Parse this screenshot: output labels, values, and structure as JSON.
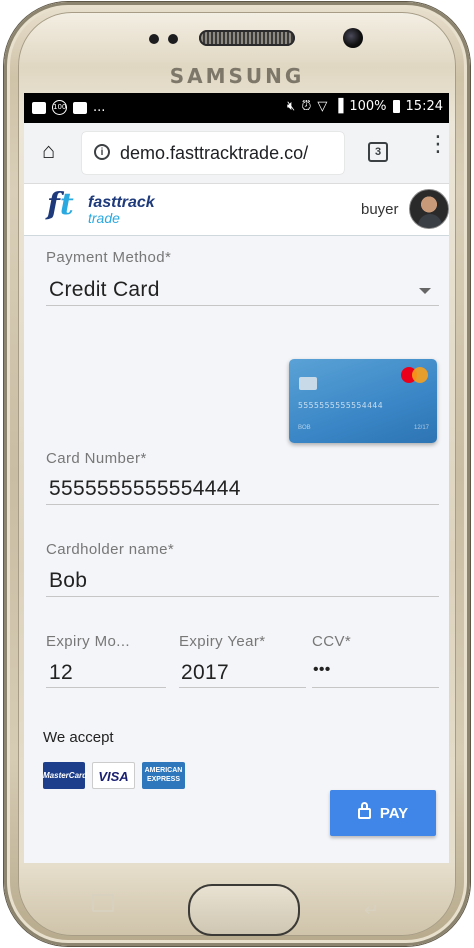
{
  "device": {
    "brand": "SAMSUNG"
  },
  "status_bar": {
    "time": "15:24",
    "battery": "100%",
    "left_extra": "..."
  },
  "browser": {
    "url": "demo.fasttracktrade.co/",
    "tab_count": "3"
  },
  "header": {
    "logo_line1": "fasttrack",
    "logo_line2": "trade",
    "logo_mark": "ft",
    "user": "buyer"
  },
  "form": {
    "payment_method": {
      "label": "Payment Method",
      "required": "*",
      "value": "Credit Card"
    },
    "card_preview": {
      "number": "5555555555554444",
      "name": "BOB",
      "expiry": "12/17"
    },
    "card_number": {
      "label": "Card Number",
      "required": "*",
      "value": "5555555555554444"
    },
    "cardholder": {
      "label": "Cardholder name",
      "required": "*",
      "value": "Bob"
    },
    "expiry_month": {
      "label": "Expiry Mo...",
      "value": "12"
    },
    "expiry_year": {
      "label": "Expiry Year",
      "required": "*",
      "value": "2017"
    },
    "ccv": {
      "label": "CCV",
      "required": "*",
      "value": "•••"
    }
  },
  "accept": {
    "label": "We accept",
    "logos": {
      "mastercard": "MasterCard",
      "visa": "VISA",
      "amex_line1": "AMERICAN",
      "amex_line2": "EXPRESS"
    }
  },
  "pay_button": {
    "label": "PAY"
  },
  "colors": {
    "accent": "#3f86e8",
    "brand_dark": "#1e3a7b",
    "brand_light": "#2aa9e0",
    "card": "#3a86c6"
  }
}
